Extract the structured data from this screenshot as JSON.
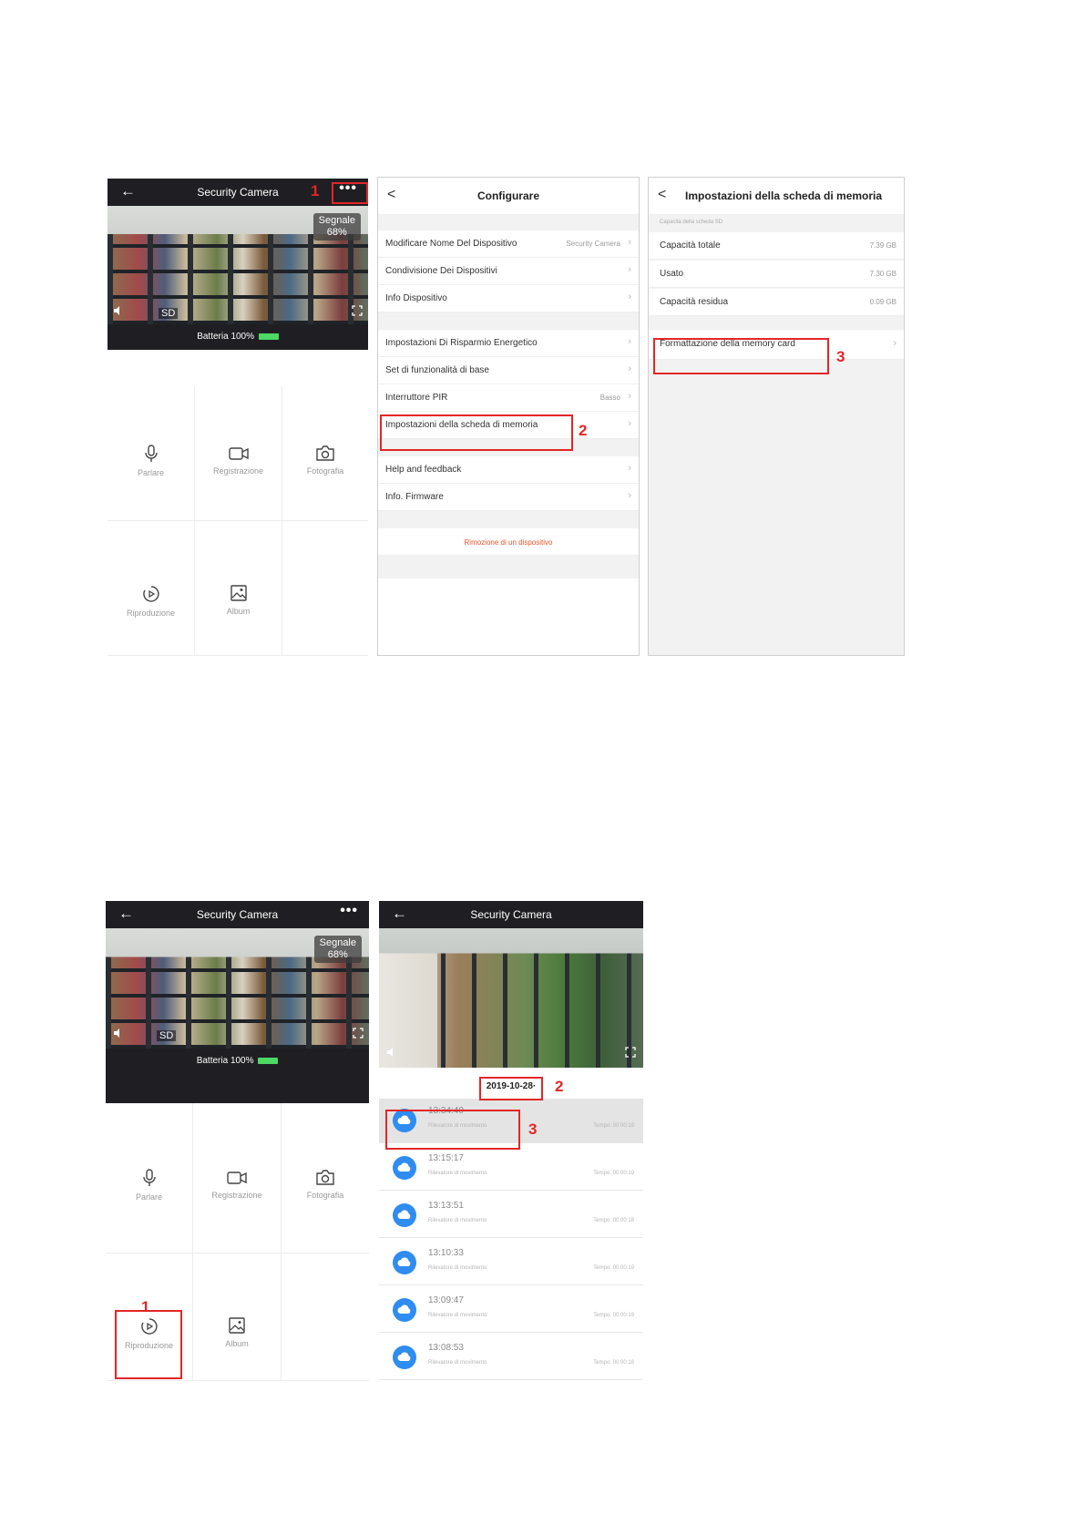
{
  "screen1": {
    "header_title": "Security Camera",
    "back": "←",
    "more": "•••",
    "signal_label": "Segnale",
    "signal_value": "68%",
    "sd_label": "SD",
    "battery_label": "Batteria",
    "battery_value": "100%",
    "battery_level": 1.0,
    "actions": [
      "Parlare",
      "Registrazione",
      "Fotografia",
      "Riproduzione",
      "Album"
    ],
    "annotation_1": "1"
  },
  "screen2": {
    "title": "Configurare",
    "back": "<",
    "rows": [
      {
        "label": "Modificare Nome Del Dispositivo",
        "value": "Security Camera"
      },
      {
        "label": "Condivisione Dei Dispositivi",
        "value": ""
      },
      {
        "label": "Info Dispositivo",
        "value": ""
      },
      {
        "label": "Impostazioni Di Risparmio Energetico",
        "value": ""
      },
      {
        "label": "Set di funzionalità di base",
        "value": ""
      },
      {
        "label": "Interruttore PIR",
        "value": "Basso"
      },
      {
        "label": "Impostazioni della scheda di memoria",
        "value": ""
      },
      {
        "label": "Help and feedback",
        "value": ""
      },
      {
        "label": "Info. Firmware",
        "value": ""
      }
    ],
    "remove_device": "Rimozione di un dispositivo",
    "annotation_2": "2"
  },
  "screen3": {
    "title": "Impostazioni della scheda di memoria",
    "back": "<",
    "section_label": "Capacità della scheda SD",
    "rows": [
      {
        "label": "Capacità totale",
        "value": "7.39 GB"
      },
      {
        "label": "Usato",
        "value": "7.30 GB"
      },
      {
        "label": "Capacità residua",
        "value": "0.09 GB"
      }
    ],
    "format_label": "Formattazione della memory card",
    "annotation_3": "3"
  },
  "screen4": {
    "header_title": "Security Camera",
    "back": "←",
    "more": "•••",
    "signal_label": "Segnale",
    "signal_value": "68%",
    "sd_label": "SD",
    "battery_label": "Batteria",
    "battery_value": "100%",
    "actions": [
      "Parlare",
      "Registrazione",
      "Fotografia",
      "Riproduzione",
      "Album"
    ],
    "annotation_1": "1"
  },
  "screen5": {
    "header_title": "Security Camera",
    "back": "←",
    "date": "2019-10-28·",
    "annotation_2": "2",
    "annotation_3": "3",
    "events": [
      {
        "time": "13:34:40",
        "type": "Rilevatore di movimento",
        "duration": "Tempo: 00:00:19"
      },
      {
        "time": "13:15:17",
        "type": "Rilevatore di movimento",
        "duration": "Tempo: 00:00:19"
      },
      {
        "time": "13:13:51",
        "type": "Rilevatore di movimento",
        "duration": "Tempo: 00:00:18"
      },
      {
        "time": "13:10:33",
        "type": "Rilevatore di movimento",
        "duration": "Tempo: 00:00:19"
      },
      {
        "time": "13:09:47",
        "type": "Rilevatore di movimento",
        "duration": "Tempo: 00:00:19"
      },
      {
        "time": "13:08:53",
        "type": "Rilevatore di movimento",
        "duration": "Tempo: 00:00:18"
      }
    ]
  }
}
